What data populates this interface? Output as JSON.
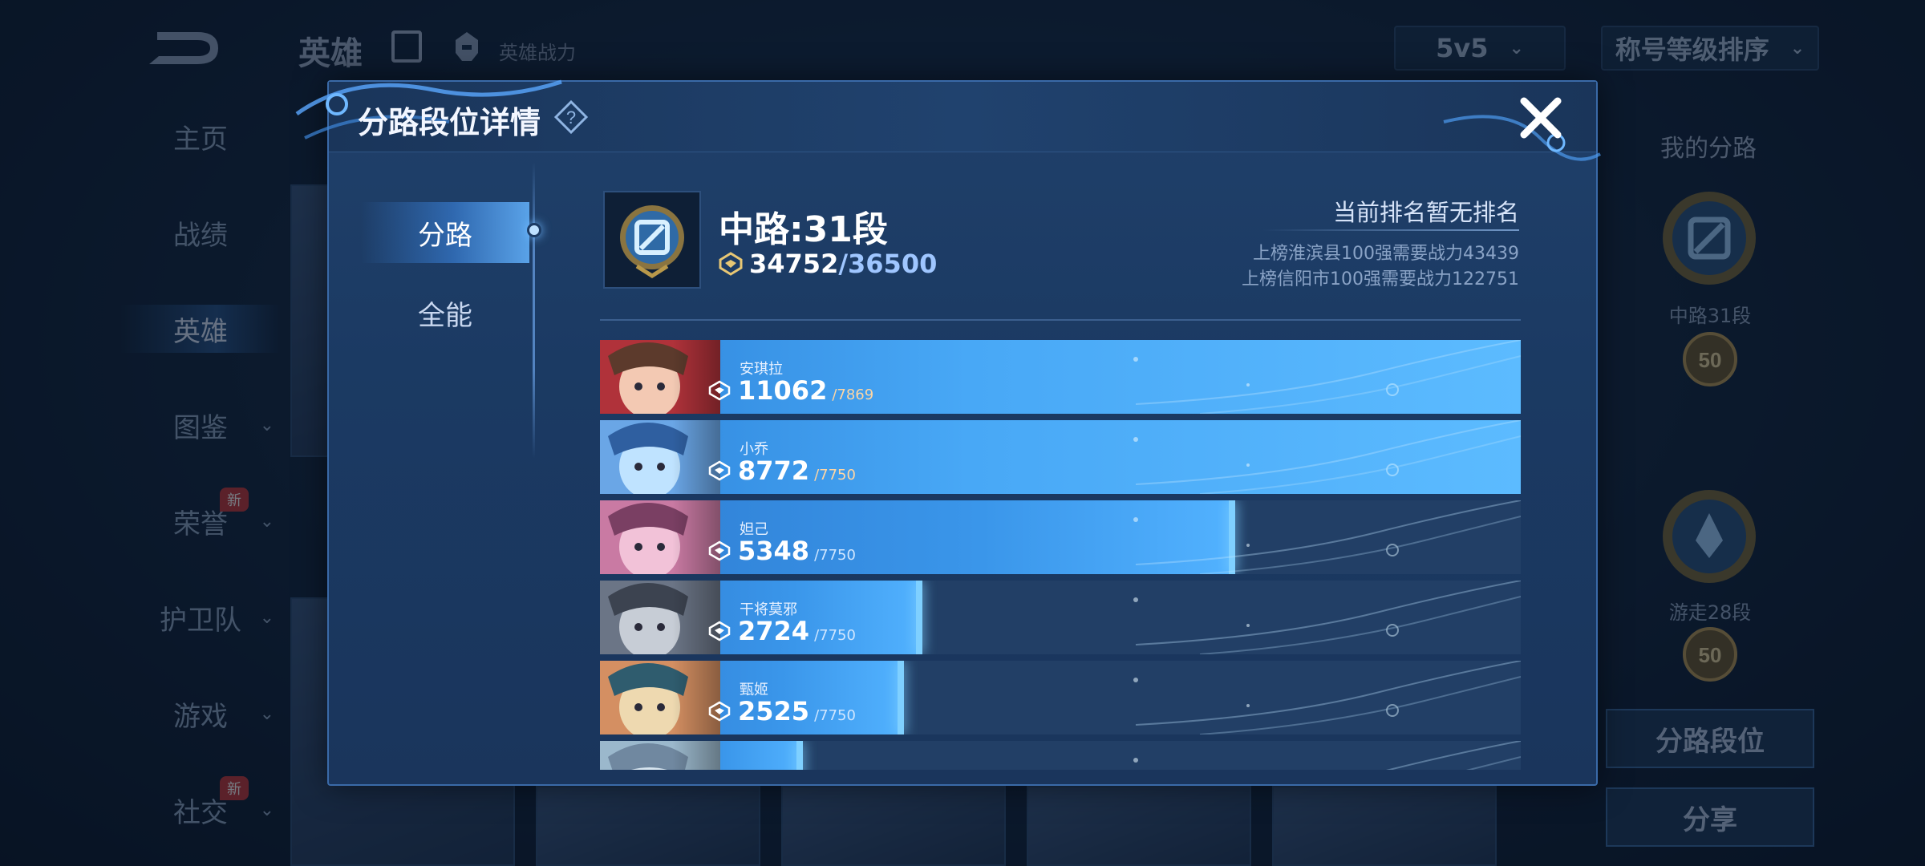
{
  "background": {
    "top_title": "英雄",
    "top_sub": "英雄战力",
    "mode_dropdown": "5v5",
    "sort_dropdown": "称号等级排序",
    "nav": [
      {
        "label": "主页",
        "chevron": false,
        "new": false
      },
      {
        "label": "战绩",
        "chevron": false,
        "new": false
      },
      {
        "label": "英雄",
        "chevron": false,
        "new": false,
        "active": true
      },
      {
        "label": "图鉴",
        "chevron": true,
        "new": false
      },
      {
        "label": "荣誉",
        "chevron": true,
        "new": true
      },
      {
        "label": "护卫队",
        "chevron": true,
        "new": false
      },
      {
        "label": "游戏",
        "chevron": true,
        "new": false
      },
      {
        "label": "社交",
        "chevron": true,
        "new": true
      }
    ],
    "new_badge": "新",
    "right_panel": {
      "title": "我的分路",
      "emblem1_label": "中路31段",
      "emblem2_label": "游走28段",
      "badge_value": "50",
      "button_lane_rank": "分路段位",
      "button_share": "分享"
    }
  },
  "modal": {
    "title": "分路段位详情",
    "tabs": [
      "分路",
      "全能"
    ],
    "active_tab": 0,
    "lane_title": "中路:31段",
    "power_current": "34752",
    "power_separator": "/",
    "power_max": "36500",
    "rank_status": "当前排名暂无排名",
    "requirements": [
      "上榜淮滨县100强需要战力43439",
      "上榜信阳市100强需要战力122751"
    ],
    "heroes": [
      {
        "name": "安琪拉",
        "value": "11062",
        "max": "/7869",
        "progress": 1.0,
        "max_color": "orange"
      },
      {
        "name": "小乔",
        "value": "8772",
        "max": "/7750",
        "progress": 1.0,
        "max_color": "orange"
      },
      {
        "name": "妲己",
        "value": "5348",
        "max": "/7750",
        "progress": 0.69,
        "max_color": "blue"
      },
      {
        "name": "干将莫邪",
        "value": "2724",
        "max": "/7750",
        "progress": 0.35,
        "max_color": "blue"
      },
      {
        "name": "甄姬",
        "value": "2525",
        "max": "/7750",
        "progress": 0.33,
        "max_color": "blue"
      },
      {
        "name": "",
        "value": "",
        "max": "",
        "progress": 0.22,
        "max_color": "blue"
      }
    ]
  }
}
